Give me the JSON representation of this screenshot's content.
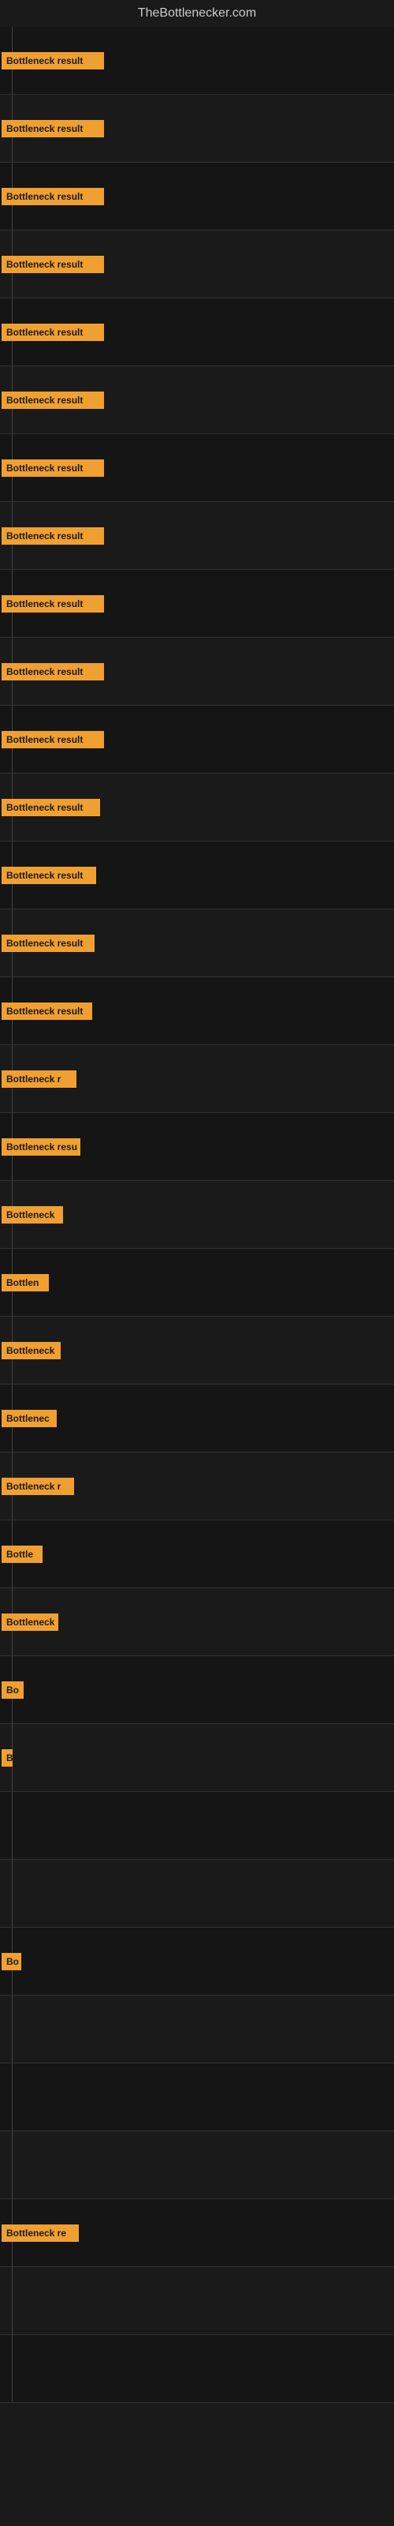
{
  "site": {
    "title": "TheBottlenecker.com"
  },
  "bars": [
    {
      "label": "Bottleneck result",
      "width": 130,
      "truncated": false
    },
    {
      "label": "Bottleneck result",
      "width": 130,
      "truncated": false
    },
    {
      "label": "Bottleneck result",
      "width": 130,
      "truncated": false
    },
    {
      "label": "Bottleneck result",
      "width": 130,
      "truncated": false
    },
    {
      "label": "Bottleneck result",
      "width": 130,
      "truncated": false
    },
    {
      "label": "Bottleneck result",
      "width": 130,
      "truncated": false
    },
    {
      "label": "Bottleneck result",
      "width": 130,
      "truncated": false
    },
    {
      "label": "Bottleneck result",
      "width": 130,
      "truncated": false
    },
    {
      "label": "Bottleneck result",
      "width": 130,
      "truncated": false
    },
    {
      "label": "Bottleneck result",
      "width": 130,
      "truncated": false
    },
    {
      "label": "Bottleneck result",
      "width": 130,
      "truncated": false
    },
    {
      "label": "Bottleneck result",
      "width": 125,
      "truncated": false
    },
    {
      "label": "Bottleneck result",
      "width": 120,
      "truncated": false
    },
    {
      "label": "Bottleneck result",
      "width": 118,
      "truncated": false
    },
    {
      "label": "Bottleneck result",
      "width": 115,
      "truncated": false
    },
    {
      "label": "Bottleneck r",
      "width": 95,
      "truncated": true
    },
    {
      "label": "Bottleneck resu",
      "width": 100,
      "truncated": true
    },
    {
      "label": "Bottleneck",
      "width": 78,
      "truncated": true
    },
    {
      "label": "Bottlen",
      "width": 60,
      "truncated": true
    },
    {
      "label": "Bottleneck",
      "width": 75,
      "truncated": true
    },
    {
      "label": "Bottlenec",
      "width": 70,
      "truncated": true
    },
    {
      "label": "Bottleneck r",
      "width": 92,
      "truncated": true
    },
    {
      "label": "Bottle",
      "width": 52,
      "truncated": true
    },
    {
      "label": "Bottleneck",
      "width": 72,
      "truncated": true
    },
    {
      "label": "Bo",
      "width": 28,
      "truncated": true
    },
    {
      "label": "B",
      "width": 14,
      "truncated": true
    },
    {
      "label": "",
      "width": 0,
      "truncated": true
    },
    {
      "label": "",
      "width": 0,
      "truncated": true
    },
    {
      "label": "Bo",
      "width": 25,
      "truncated": true
    },
    {
      "label": "",
      "width": 0,
      "truncated": true
    },
    {
      "label": "",
      "width": 0,
      "truncated": true
    },
    {
      "label": "",
      "width": 0,
      "truncated": true
    },
    {
      "label": "Bottleneck re",
      "width": 98,
      "truncated": true
    },
    {
      "label": "",
      "width": 0,
      "truncated": true
    },
    {
      "label": "",
      "width": 0,
      "truncated": true
    }
  ]
}
